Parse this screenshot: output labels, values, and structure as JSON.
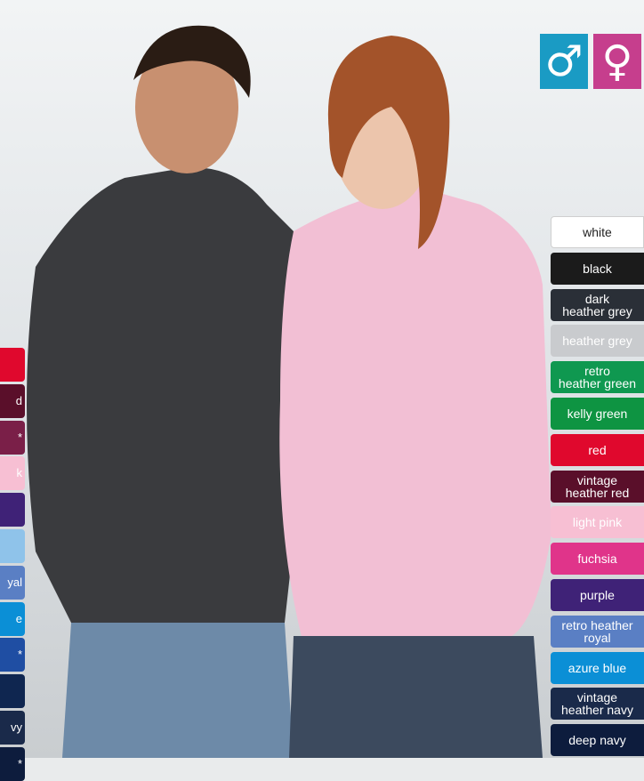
{
  "gender_icons": {
    "male": {
      "symbol": "♂",
      "color": "#1a9bc4"
    },
    "female": {
      "symbol": "♀",
      "color": "#c63e8d"
    }
  },
  "right_swatches": [
    {
      "label": "white",
      "bg": "#ffffff",
      "fg": "#222222",
      "border": "#cfcfcf"
    },
    {
      "label": "black",
      "bg": "#1b1b1b",
      "fg": "#ffffff"
    },
    {
      "label": "dark\nheather grey",
      "bg": "#2a2f37",
      "fg": "#ffffff"
    },
    {
      "label": "heather grey",
      "bg": "#c9cbce",
      "fg": "#ffffff"
    },
    {
      "label": "retro\nheather green",
      "bg": "#0f9850",
      "fg": "#ffffff"
    },
    {
      "label": "kelly green",
      "bg": "#0e9442",
      "fg": "#ffffff"
    },
    {
      "label": "red",
      "bg": "#e0082d",
      "fg": "#ffffff"
    },
    {
      "label": "vintage\nheather red",
      "bg": "#5a0f2a",
      "fg": "#ffffff"
    },
    {
      "label": "light pink",
      "bg": "#f7bfd3",
      "fg": "#ffffff"
    },
    {
      "label": "fuchsia",
      "bg": "#e0348a",
      "fg": "#ffffff"
    },
    {
      "label": "purple",
      "bg": "#3f2277",
      "fg": "#ffffff"
    },
    {
      "label": "retro heather\nroyal",
      "bg": "#5a7fc4",
      "fg": "#ffffff"
    },
    {
      "label": "azure blue",
      "bg": "#0b8fd6",
      "fg": "#ffffff"
    },
    {
      "label": "vintage\nheather navy",
      "bg": "#1a2a4a",
      "fg": "#ffffff"
    },
    {
      "label": "deep navy",
      "bg": "#0d1c3d",
      "fg": "#ffffff"
    }
  ],
  "left_swatches": [
    {
      "label": "",
      "bg": "#e0082d"
    },
    {
      "label": "d",
      "bg": "#5a0f2a"
    },
    {
      "label": "*",
      "bg": "#7a1f48"
    },
    {
      "label": "k",
      "bg": "#f7bfd3"
    },
    {
      "label": "",
      "bg": "#3f2277"
    },
    {
      "label": "",
      "bg": "#8fc3ea"
    },
    {
      "label": "yal",
      "bg": "#5a7fc4"
    },
    {
      "label": "e",
      "bg": "#0b8fd6"
    },
    {
      "label": "*",
      "bg": "#1f4ea3"
    },
    {
      "label": "",
      "bg": "#0f2650"
    },
    {
      "label": "vy",
      "bg": "#1a2a4a"
    },
    {
      "label": "*",
      "bg": "#0d1c3d"
    }
  ]
}
